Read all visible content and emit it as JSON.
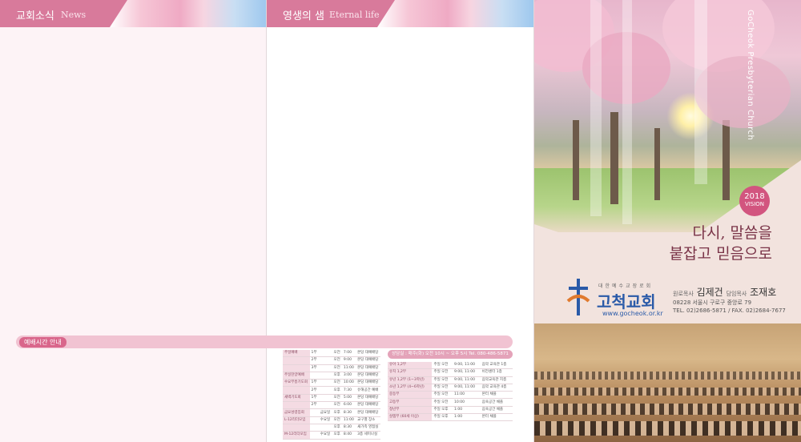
{
  "panel_news": {
    "title_kr": "교회소식",
    "title_en": "News"
  },
  "panel_life": {
    "title_kr": "영생의 샘",
    "title_en": "Eternal life"
  },
  "worship": {
    "title": "예배시간 안내",
    "note": "상담실 : 매주(화) 오전 10시 ~ 오후 5시 Tel. 080-486-5871",
    "left_rows": [
      {
        "group": "주일예배",
        "part": "1부",
        "day": "",
        "time": "오전",
        "hour": "7:00",
        "place": "본당 대예배당"
      },
      {
        "group": "",
        "part": "2부",
        "day": "",
        "time": "오전",
        "hour": "9:00",
        "place": "본당 대예배당"
      },
      {
        "group": "",
        "part": "3부",
        "day": "",
        "time": "오전",
        "hour": "11:00",
        "place": "본당 대예배당"
      },
      {
        "group": "주일찬양예배",
        "part": "",
        "day": "",
        "time": "오후",
        "hour": "3:00",
        "place": "본당 대예배당"
      },
      {
        "group": "수요부흥기도회",
        "part": "1부",
        "day": "",
        "time": "오전",
        "hour": "10:00",
        "place": "본당 대예배당"
      },
      {
        "group": "",
        "part": "2부",
        "day": "",
        "time": "오후",
        "hour": "7:30",
        "place": "유해공간 예배"
      },
      {
        "group": "새벽기도회",
        "part": "1부",
        "day": "",
        "time": "오전",
        "hour": "5:00",
        "place": "본당 대예배당"
      },
      {
        "group": "",
        "part": "2부",
        "day": "",
        "time": "오전",
        "hour": "6:00",
        "place": "본당 대예배당"
      },
      {
        "group": "금요성령집회",
        "part": "",
        "day": "금요일",
        "time": "오후",
        "hour": "8:30",
        "place": "본당 대예배당"
      },
      {
        "group": "L-12리더모임",
        "part": "",
        "day": "수요일",
        "time": "오전",
        "hour": "11:00",
        "place": "교구별 장소"
      },
      {
        "group": "",
        "part": "",
        "day": "",
        "time": "오후",
        "hour": "8:30",
        "place": "새가족 영접실"
      },
      {
        "group": "M-12리더모임",
        "part": "",
        "day": "수요일",
        "time": "오후",
        "hour": "8:40",
        "place": "3층 세미나실"
      }
    ],
    "right_rows": [
      {
        "name": "유아 1,2부",
        "time": "주일 오전",
        "hour": "9:00, 11:00",
        "place": "음악 교육관 1층"
      },
      {
        "name": "유치 1,2부",
        "time": "주일 오전",
        "hour": "9:00, 11:00",
        "place": "비전센터 1층"
      },
      {
        "name": "유년 1,2부 (1~3학년)",
        "time": "주일 오전",
        "hour": "9:00, 11:00",
        "place": "음악교육관 지층"
      },
      {
        "name": "소년 1,2부 (4~6학년)",
        "time": "주일 오전",
        "hour": "9:00, 11:00",
        "place": "음악 교육관 4층"
      },
      {
        "name": "중등부",
        "time": "주일 오전",
        "hour": "11:00",
        "place": "본터 채플"
      },
      {
        "name": "고등부",
        "time": "주일 오전",
        "hour": "10:00",
        "place": "음육공간 채플"
      },
      {
        "name": "청년부",
        "time": "주일 오후",
        "hour": "1:00",
        "place": "음육공간 채플"
      },
      {
        "name": "살렘부 (60세 이상)",
        "time": "주일 오후",
        "hour": "1:00",
        "place": "본터 채플"
      }
    ]
  },
  "cover": {
    "vertical_name": "GoCheok Presbyterian Church",
    "vision_year": "2018",
    "vision_label": "VISION",
    "slogan_line1": "다시, 말씀을",
    "slogan_line2": "붙잡고 믿음으로",
    "denomination": "대한예수교장로회",
    "church_name": "고척교회",
    "url": "www.gocheok.or.kr",
    "pastor1_title": "원로목사",
    "pastor1_name": "김제건",
    "pastor2_title": "담임목사",
    "pastor2_name": "조재호",
    "address": "08228 서울시 구로구 중앙로 79",
    "tel": "TEL. 02)2686-5871 / FAX. 02)2684-7677"
  },
  "colors": {
    "accent_pink": "#d87a9b",
    "brand_blue": "#2a5aa8",
    "slogan": "#7a3448",
    "vision_badge": "#d2557f"
  }
}
